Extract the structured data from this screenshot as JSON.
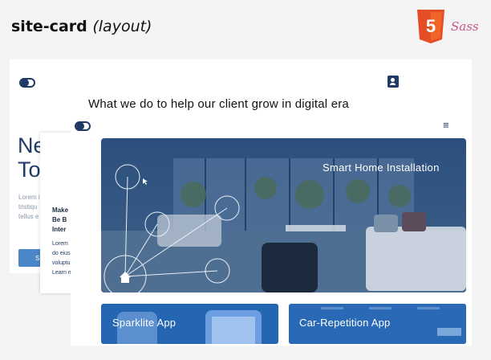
{
  "header": {
    "title": "site-card",
    "subtitle": "(layout)",
    "sass_logo": "Sass",
    "html5_logo": "5"
  },
  "back_card": {
    "heading": "What we do to help our client grow in digital era",
    "big_text_line1": "Ne",
    "big_text_line2": "To",
    "lorem_line1": "Lorem i",
    "lorem_line2": "tristiqu",
    "lorem_line3": "tellus e",
    "button_label": "S"
  },
  "mid_card": {
    "head_line1": "Make",
    "head_line2": "Be B",
    "head_line3": "Inter",
    "lorem_line1": "Lorem",
    "lorem_line2": "do eius",
    "lorem_line3": "voluptu",
    "link": "Learn m"
  },
  "front_card": {
    "hero_label": "Smart Home Installation",
    "tiles": [
      {
        "label": "Sparklite App"
      },
      {
        "label": "Car-Repetition App"
      }
    ],
    "menu_icon": "≡"
  },
  "colors": {
    "navy": "#1f3a66",
    "tile_blue": "#2466b2",
    "accent_blue": "#3b7fd1",
    "html5_orange": "#e44d26",
    "sass_pink": "#c6538c"
  },
  "icons": [
    "toggle-icon",
    "contact-book-icon",
    "menu-icon",
    "home-icon",
    "html5-logo",
    "sass-logo"
  ]
}
